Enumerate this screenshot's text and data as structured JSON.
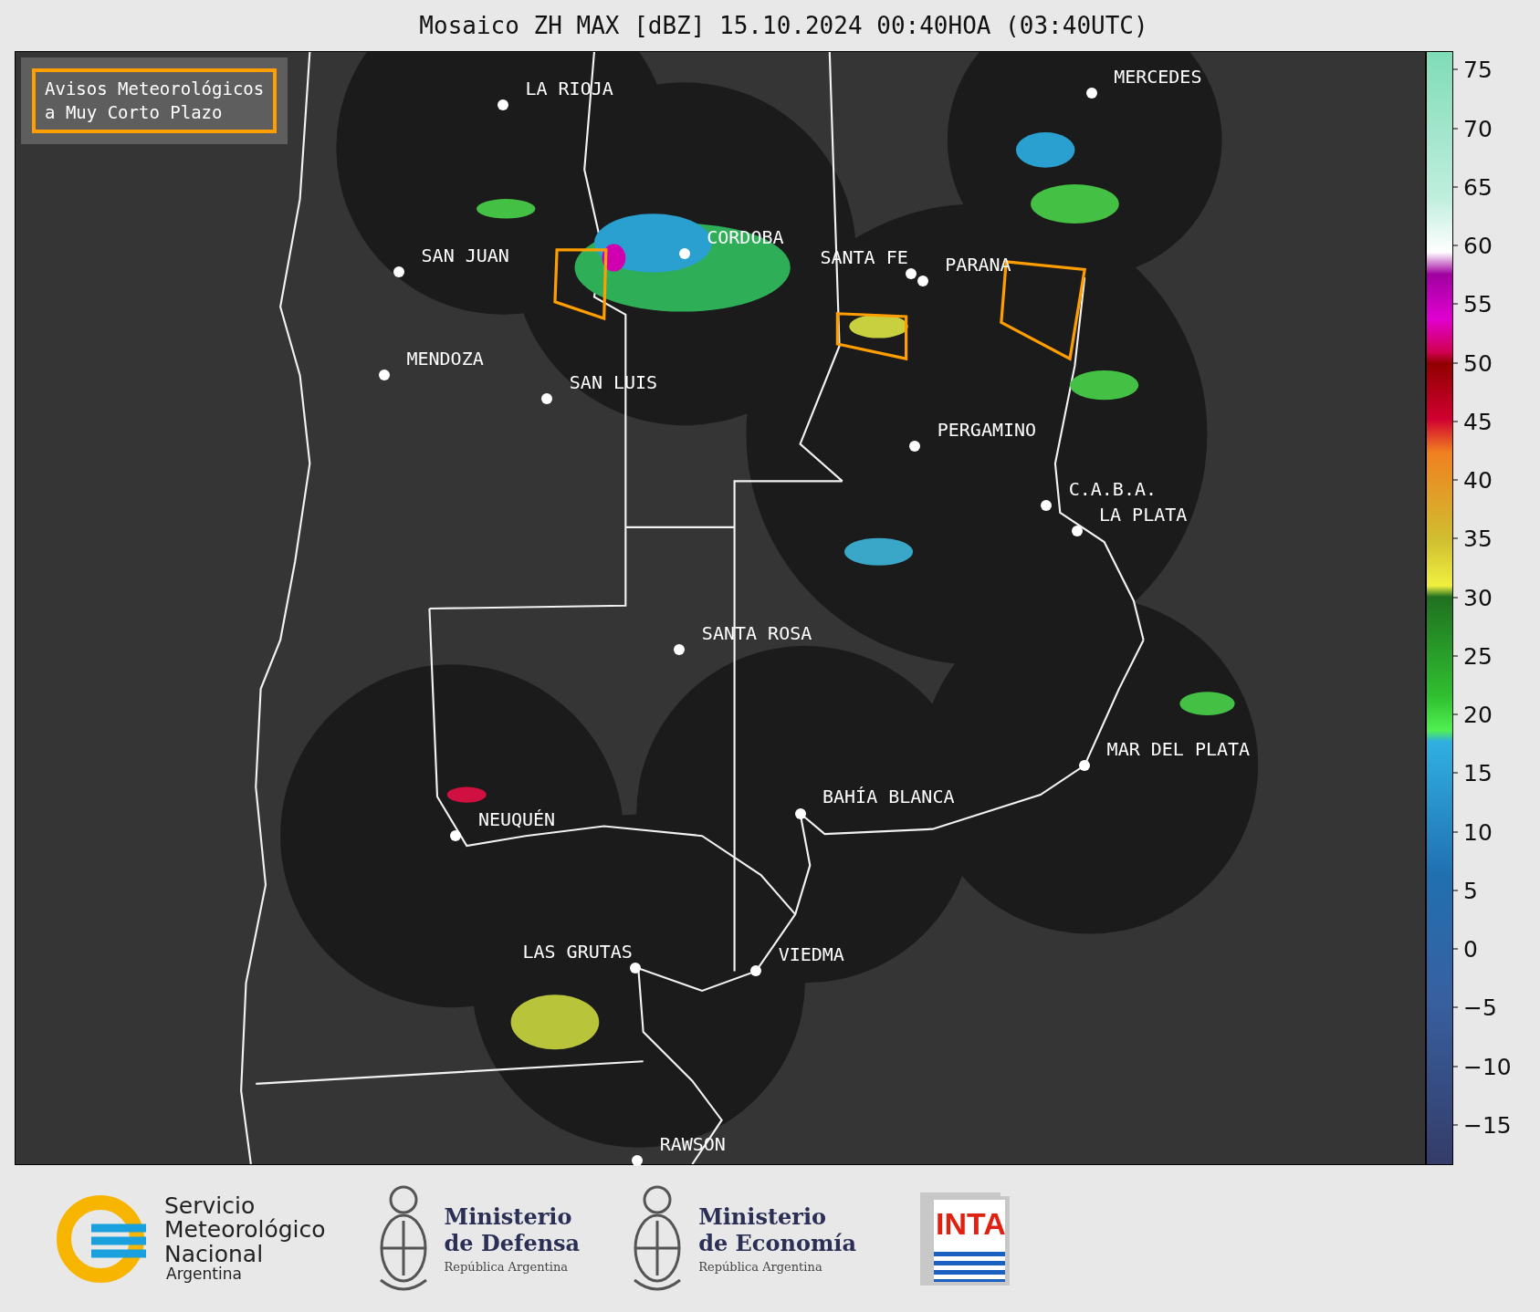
{
  "title": "Mosaico ZH MAX [dBZ] 15.10.2024 00:40HOA (03:40UTC)",
  "legend": {
    "label": "Avisos Meteorológicos\na Muy Corto Plazo"
  },
  "cities": [
    {
      "name": "LA RIOJA"
    },
    {
      "name": "MERCEDES"
    },
    {
      "name": "CORDOBA"
    },
    {
      "name": "SAN JUAN"
    },
    {
      "name": "SANTA FE"
    },
    {
      "name": "PARANA"
    },
    {
      "name": "MENDOZA"
    },
    {
      "name": "SAN LUIS"
    },
    {
      "name": "PERGAMINO"
    },
    {
      "name": "C.A.B.A."
    },
    {
      "name": "LA PLATA"
    },
    {
      "name": "SANTA ROSA"
    },
    {
      "name": "MAR DEL PLATA"
    },
    {
      "name": "BAHÍA BLANCA"
    },
    {
      "name": "NEUQUÉN"
    },
    {
      "name": "LAS GRUTAS"
    },
    {
      "name": "VIEDMA"
    },
    {
      "name": "RAWSON"
    }
  ],
  "colorbar": {
    "ticks": [
      "75",
      "70",
      "65",
      "60",
      "55",
      "50",
      "45",
      "40",
      "35",
      "30",
      "25",
      "20",
      "15",
      "10",
      "5",
      "0",
      "−5",
      "−10",
      "−15"
    ]
  },
  "footer": [
    {
      "kind": "smn",
      "lines": [
        "Servicio",
        "Meteorológico",
        "Nacional",
        "Argentina"
      ]
    },
    {
      "kind": "ministry",
      "lines": [
        "Ministerio",
        "de Defensa",
        "República Argentina"
      ]
    },
    {
      "kind": "ministry",
      "lines": [
        "Ministerio",
        "de Economía",
        "República Argentina"
      ]
    },
    {
      "kind": "inta",
      "lines": [
        "INTA"
      ]
    }
  ]
}
